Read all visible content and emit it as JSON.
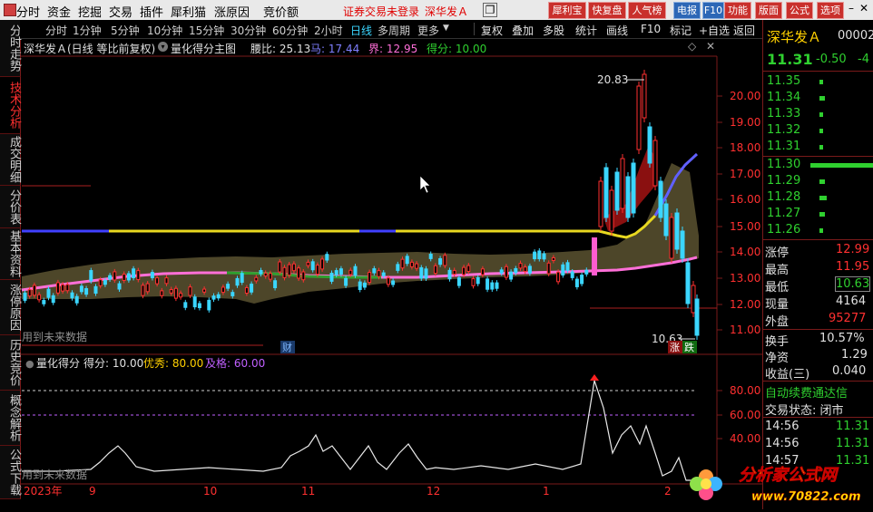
{
  "menu": {
    "items": [
      "分时",
      "资金",
      "挖掘",
      "交易",
      "插件",
      "犀利猫",
      "涨原因",
      "竞价额"
    ],
    "warning": "证券交易未登录",
    "stock_title": "深华发Ａ",
    "buttons": [
      "犀利宝",
      "快复盘",
      "人气榜",
      "电报",
      "F10",
      "功能",
      "版面",
      "公式",
      "选项"
    ]
  },
  "sidebar": [
    "分时走势",
    "技术分析",
    "成交明细",
    "分价表",
    "基本资料",
    "涨停原因",
    "历史竞价",
    "概念解析",
    "公式下载"
  ],
  "toolbar": {
    "periods": [
      "分时",
      "1分钟",
      "5分钟",
      "10分钟",
      "15分钟",
      "30分钟",
      "60分钟",
      "2小时",
      "日线",
      "多周期",
      "更多"
    ],
    "selected": "日线",
    "actions": [
      "复权",
      "叠加",
      "多股",
      "统计",
      "画线",
      "F10",
      "标记",
      "+自选",
      "返回"
    ]
  },
  "main_header": {
    "title": "深华发Ａ(日线 等比前复权)",
    "indicator": "量化得分主图",
    "items": [
      {
        "label": "腰比: 25.13",
        "color": "#e0e0e0"
      },
      {
        "label": "马: 17.44",
        "color": "#7f7fff"
      },
      {
        "label": "界: 12.95",
        "color": "#ff6fd8"
      },
      {
        "label": "得分: 10.00",
        "color": "#2fd02f"
      }
    ]
  },
  "price_axis": [
    "20.00",
    "19.00",
    "18.00",
    "17.00",
    "16.00",
    "15.00",
    "14.00",
    "13.00",
    "12.00",
    "11.00"
  ],
  "annotations": {
    "high": "20.83",
    "low": "10.63",
    "future_note": "用到未来数据",
    "cai": "财",
    "zhang": "涨",
    "die": "跌"
  },
  "sub_header": {
    "indicator": "量化得分",
    "items": [
      {
        "label": "得分: 10.00",
        "color": "#e0e0e0"
      },
      {
        "label": "优秀: 80.00",
        "color": "#ffd000"
      },
      {
        "label": "及格: 60.00",
        "color": "#c060ff"
      }
    ]
  },
  "sub_axis": [
    "80.00",
    "60.00",
    "40.00"
  ],
  "time_axis": [
    "2023年",
    "9",
    "10",
    "11",
    "12",
    "1",
    "2"
  ],
  "quote": {
    "name": "深华发Ａ",
    "code": "00002",
    "price": "11.31",
    "change": "-0.50",
    "change_pct": "-4",
    "asks": [
      "11.35",
      "11.34",
      "11.33",
      "11.32",
      "11.31"
    ],
    "bids": [
      "11.30",
      "11.29",
      "11.28",
      "11.27",
      "11.26"
    ],
    "stats": [
      {
        "label": "涨停",
        "value": "12.99",
        "color": "#ff3030"
      },
      {
        "label": "最高",
        "value": "11.95",
        "color": "#ff3030"
      },
      {
        "label": "最低",
        "value": "10.63",
        "color": "#2fd02f"
      },
      {
        "label": "现量",
        "value": "4164",
        "color": "#e0e0e0"
      },
      {
        "label": "外盘",
        "value": "95277",
        "color": "#ff3030"
      },
      {
        "label": "换手",
        "value": "10.57%",
        "color": "#e0e0e0"
      },
      {
        "label": "净资",
        "value": "1.29",
        "color": "#e0e0e0"
      },
      {
        "label": "收益(三)",
        "value": "0.040",
        "color": "#e0e0e0"
      }
    ],
    "notice1": "自动续费通达信",
    "notice2": "交易状态: 闭市",
    "ticks": [
      {
        "time": "14:56",
        "price": "11.31"
      },
      {
        "time": "14:56",
        "price": "11.31"
      },
      {
        "time": "14:57",
        "price": "11.31"
      }
    ]
  },
  "logo": {
    "title": "分析家公式网",
    "url": "www.70822.com"
  }
}
